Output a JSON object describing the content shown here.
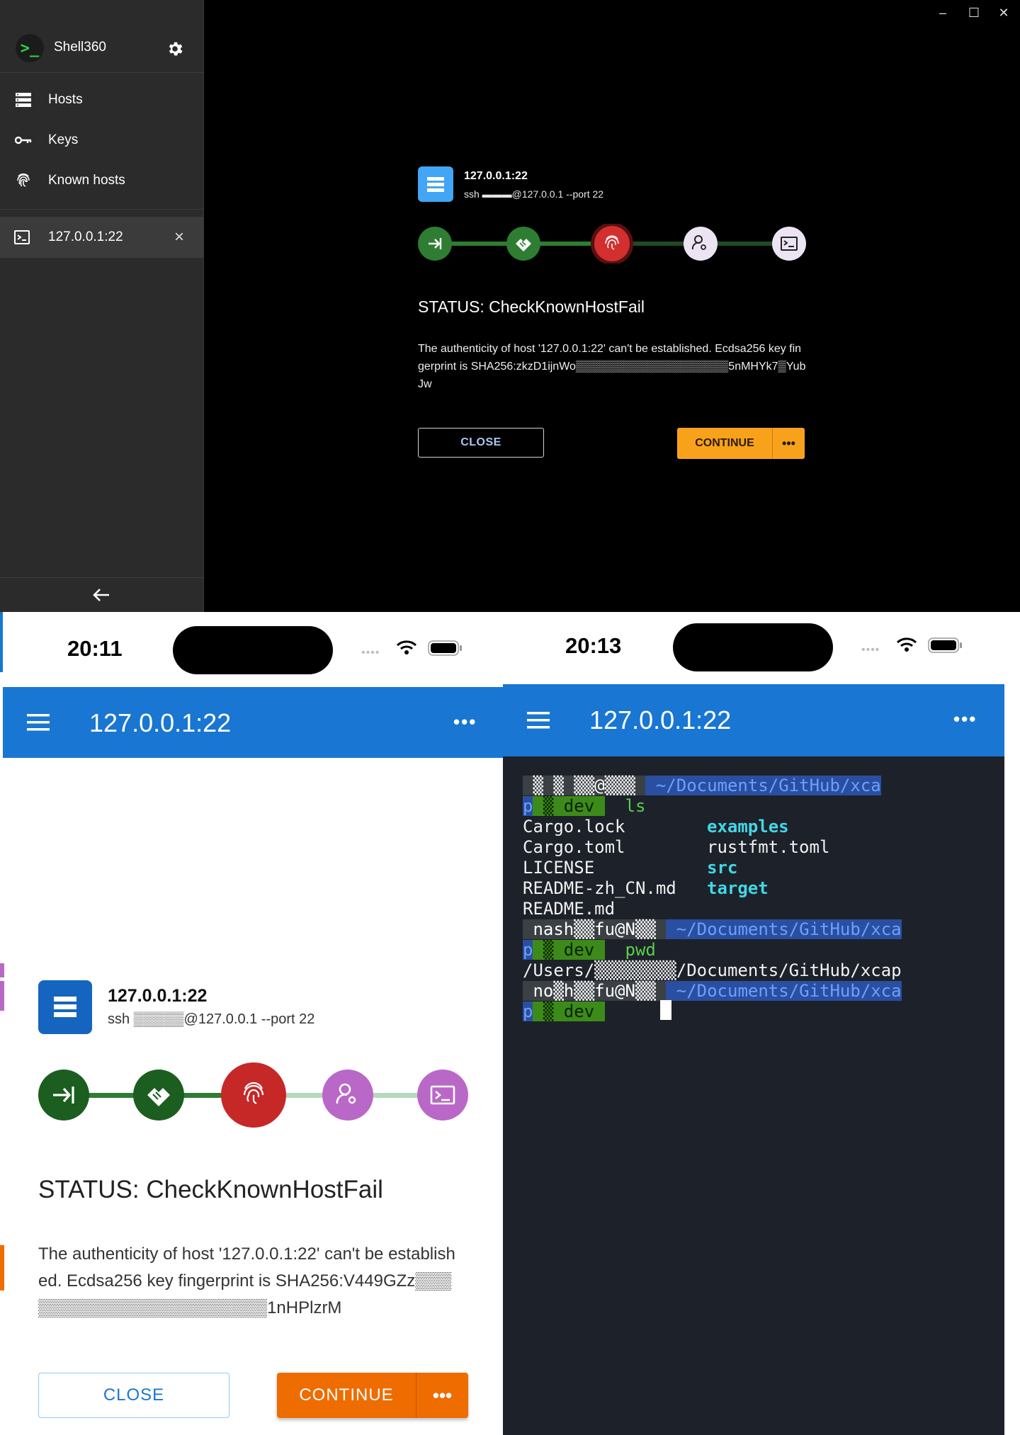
{
  "desktop": {
    "app_name": "Shell360",
    "logo_glyph": ">_",
    "nav": [
      {
        "label": "Hosts",
        "icon": "hosts-icon"
      },
      {
        "label": "Keys",
        "icon": "key-icon"
      },
      {
        "label": "Known hosts",
        "icon": "fingerprint-icon"
      }
    ],
    "session": {
      "label": "127.0.0.1:22",
      "icon": "terminal-icon"
    },
    "window_controls": [
      "–",
      "☐",
      "✕"
    ],
    "host": {
      "title": "127.0.0.1:22",
      "command": "ssh ▬▬▬@127.0.0.1 --port 22"
    },
    "steps": [
      {
        "icon": "login-icon",
        "state": "done"
      },
      {
        "icon": "handshake-icon",
        "state": "done"
      },
      {
        "icon": "fingerprint-icon",
        "state": "error"
      },
      {
        "icon": "user-key-icon",
        "state": "pending"
      },
      {
        "icon": "terminal-icon",
        "state": "pending"
      }
    ],
    "status": "STATUS: CheckKnownHostFail",
    "message": "The authenticity of host '127.0.0.1:22' can't be established. Ecdsa256 key fingerprint is SHA256:zkzD1ijnWo▒▒▒▒▒▒▒▒▒▒▒▒▒▒▒▒▒▒▒5nMHYk7▒YubJw",
    "close_label": "CLOSE",
    "continue_label": "CONTINUE",
    "more_label": "•••",
    "colors": {
      "done": "#2e7d32",
      "error": "#d32f2f",
      "pending": "#ece4f2",
      "accent": "#f8a21b",
      "host_icon": "#42a5f5"
    }
  },
  "phone1": {
    "time": "20:11",
    "title": "127.0.0.1:22",
    "host": {
      "title": "127.0.0.1:22",
      "command": "ssh ▒▒▒▒▒@127.0.0.1 --port 22"
    },
    "status": "STATUS: CheckKnownHostFail",
    "message": "The authenticity of host '127.0.0.1:22' can't be established. Ecdsa256 key fingerprint is SHA256:V449GZz▒▒▒▒▒▒▒▒▒▒▒▒▒▒▒▒▒▒▒▒▒▒1nHPlzrM",
    "close_label": "CLOSE",
    "continue_label": "CONTINUE",
    "more_label": "•••",
    "colors": {
      "appbar": "#1976d2",
      "done": "#1b5e20",
      "error": "#c62828",
      "pending": "#ba68c8",
      "accent": "#ef6c00"
    }
  },
  "phone2": {
    "time": "20:13",
    "title": "127.0.0.1:22",
    "terminal": {
      "prompt1_user": " ▒ ▒ ▒▒@▒▒▒ ",
      "prompt_path": " ~/Documents/GitHub/xca",
      "prompt_cont": "p",
      "branch": " ▒ dev ",
      "cmd1": "ls",
      "files_left": [
        "Cargo.lock",
        "Cargo.toml",
        "LICENSE",
        "README-zh_CN.md",
        "README.md"
      ],
      "files_right": [
        "examples",
        "rustfmt.toml",
        "src",
        "target"
      ],
      "prompt2_user": " nash▒▒fu@N▒▒ ",
      "cmd2": "pwd",
      "pwd_output": "/Users/▒▒▒▒▒▒▒▒/Documents/GitHub/xcap",
      "prompt3_user": " no▒h▒▒fu@N▒▒ "
    }
  }
}
